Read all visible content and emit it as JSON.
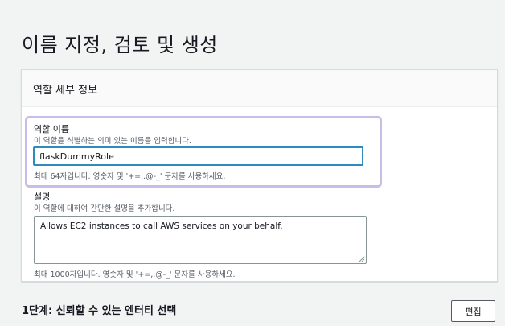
{
  "page": {
    "title": "이름 지정, 검토 및 생성"
  },
  "role_details": {
    "header": "역할 세부 정보",
    "role_name": {
      "label": "역할 이름",
      "description": "이 역할을 식별하는 의미 있는 이름을 입력합니다.",
      "value": "flaskDummyRole",
      "constraint": "최대 64자입니다. 영숫자 및 '+=,.@-_' 문자를 사용하세요."
    },
    "description": {
      "label": "설명",
      "description": "이 역할에 대하여 간단한 설명을 추가합니다.",
      "value": "Allows EC2 instances to call AWS services on your behalf.",
      "constraint": "최대 1000자입니다. 영숫자 및 '+=,.@-_' 문자를 사용하세요."
    }
  },
  "step1": {
    "title": "1단계: 신뢰할 수 있는 엔터티 선택",
    "edit_label": "편집"
  },
  "colors": {
    "highlight": "#c6bde8",
    "input_focus": "#2e8bc0",
    "background": "#f2f3f3"
  }
}
